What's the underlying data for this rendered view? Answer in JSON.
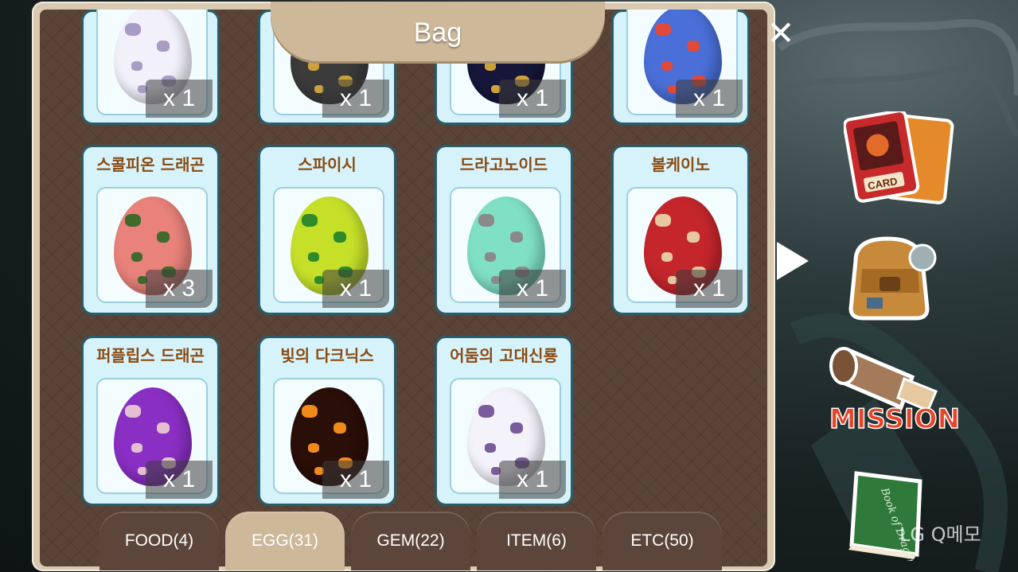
{
  "panel": {
    "title": "Bag",
    "close_symbol": "✕"
  },
  "cards": [
    {
      "name": "",
      "count": "x 1",
      "egg_color": "#f1f0fb",
      "spot_color": "#a89bc4"
    },
    {
      "name": "",
      "count": "x 1",
      "egg_color": "#3b3b3b",
      "spot_color": "#c9a23b"
    },
    {
      "name": "",
      "count": "x 1",
      "egg_color": "#16163a",
      "spot_color": "#c9a23b"
    },
    {
      "name": "",
      "count": "x 1",
      "egg_color": "#4a6fd8",
      "spot_color": "#e04a3a"
    },
    {
      "name": "스콜피온 드래곤",
      "count": "x 3",
      "egg_color": "#e8827a",
      "spot_color": "#3f6a2b"
    },
    {
      "name": "스파이시",
      "count": "x 1",
      "egg_color": "#c6e02a",
      "spot_color": "#2f8a2a"
    },
    {
      "name": "드라고노이드",
      "count": "x 1",
      "egg_color": "#7fe0c4",
      "spot_color": "#8a8a8a"
    },
    {
      "name": "볼케이노",
      "count": "x 1",
      "egg_color": "#c4262c",
      "spot_color": "#e7c8a0"
    },
    {
      "name": "퍼플립스 드래곤",
      "count": "x 1",
      "egg_color": "#8a2fc4",
      "spot_color": "#e4bfd0"
    },
    {
      "name": "빛의 다크닉스",
      "count": "x 1",
      "egg_color": "#2a0e08",
      "spot_color": "#f08a1a"
    },
    {
      "name": "어둠의 고대신룡",
      "count": "x 1",
      "egg_color": "#f4f2fb",
      "spot_color": "#7a5c9c"
    }
  ],
  "tabs": [
    {
      "label": "FOOD(4)"
    },
    {
      "label": "EGG(31)"
    },
    {
      "label": "GEM(22)"
    },
    {
      "label": "ITEM(6)"
    },
    {
      "label": "ETC(50)"
    }
  ],
  "active_tab": "EGG(31)",
  "sidebar": {
    "card_label": "CARD",
    "mission_label": "MISSION",
    "book_label": "Book of Dragons"
  },
  "watermark": "LG Q메모",
  "colors": {
    "panel_frame": "#d8c9b0",
    "panel_bg": "#5a4337",
    "card_bg": "#d6f3fb",
    "card_name": "#8a4a10",
    "active_tab": "#cdb89a"
  }
}
